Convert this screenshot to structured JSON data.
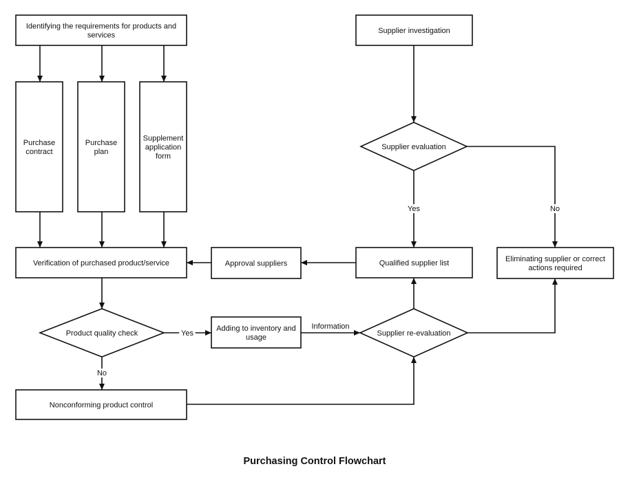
{
  "title": "Purchasing Control Flowchart",
  "nodes": {
    "requirements": {
      "shape": "process",
      "lines": [
        "Identifying the requirements for products and",
        "services"
      ]
    },
    "purchase_contract": {
      "shape": "process",
      "lines": [
        "Purchase",
        "contract"
      ]
    },
    "purchase_plan": {
      "shape": "process",
      "lines": [
        "Purchase",
        "plan"
      ]
    },
    "supplement_form": {
      "shape": "process",
      "lines": [
        "Supplement",
        "application",
        "form"
      ]
    },
    "verification": {
      "shape": "process",
      "lines": [
        "Verification of purchased product/service"
      ]
    },
    "approval_suppliers": {
      "shape": "process",
      "lines": [
        "Approval suppliers"
      ]
    },
    "qualified_list": {
      "shape": "process",
      "lines": [
        "Qualified supplier list"
      ]
    },
    "eliminating": {
      "shape": "process",
      "lines": [
        "Eliminating supplier or correct",
        "actions required"
      ]
    },
    "supplier_investigation": {
      "shape": "process",
      "lines": [
        "Supplier investigation"
      ]
    },
    "supplier_evaluation": {
      "shape": "decision",
      "lines": [
        "Supplier evaluation"
      ]
    },
    "quality_check": {
      "shape": "decision",
      "lines": [
        "Product quality check"
      ]
    },
    "adding_inventory": {
      "shape": "process",
      "lines": [
        "Adding to inventory and",
        "usage"
      ]
    },
    "supplier_reevaluation": {
      "shape": "decision",
      "lines": [
        "Supplier re-evaluation"
      ]
    },
    "nonconforming": {
      "shape": "process",
      "lines": [
        "Nonconforming product control"
      ]
    }
  },
  "edges": [
    {
      "id": "e1",
      "from": "requirements",
      "to": "purchase_contract",
      "label": ""
    },
    {
      "id": "e2",
      "from": "requirements",
      "to": "purchase_plan",
      "label": ""
    },
    {
      "id": "e3",
      "from": "requirements",
      "to": "supplement_form",
      "label": ""
    },
    {
      "id": "e4",
      "from": "purchase_contract",
      "to": "verification",
      "label": ""
    },
    {
      "id": "e5",
      "from": "purchase_plan",
      "to": "verification",
      "label": ""
    },
    {
      "id": "e6",
      "from": "supplement_form",
      "to": "verification",
      "label": ""
    },
    {
      "id": "e7",
      "from": "supplier_investigation",
      "to": "supplier_evaluation",
      "label": ""
    },
    {
      "id": "e8",
      "from": "supplier_evaluation",
      "to": "qualified_list",
      "label": "Yes"
    },
    {
      "id": "e9",
      "from": "supplier_evaluation",
      "to": "eliminating",
      "label": "No"
    },
    {
      "id": "e10",
      "from": "qualified_list",
      "to": "approval_suppliers",
      "label": ""
    },
    {
      "id": "e11",
      "from": "approval_suppliers",
      "to": "verification",
      "label": ""
    },
    {
      "id": "e12",
      "from": "verification",
      "to": "quality_check",
      "label": ""
    },
    {
      "id": "e13",
      "from": "quality_check",
      "to": "adding_inventory",
      "label": "Yes"
    },
    {
      "id": "e14",
      "from": "quality_check",
      "to": "nonconforming",
      "label": "No"
    },
    {
      "id": "e15",
      "from": "adding_inventory",
      "to": "supplier_reevaluation",
      "label": "Information"
    },
    {
      "id": "e16",
      "from": "nonconforming",
      "to": "supplier_reevaluation",
      "label": ""
    },
    {
      "id": "e17",
      "from": "supplier_reevaluation",
      "to": "qualified_list",
      "label": ""
    },
    {
      "id": "e18",
      "from": "supplier_reevaluation",
      "to": "eliminating",
      "label": ""
    }
  ]
}
